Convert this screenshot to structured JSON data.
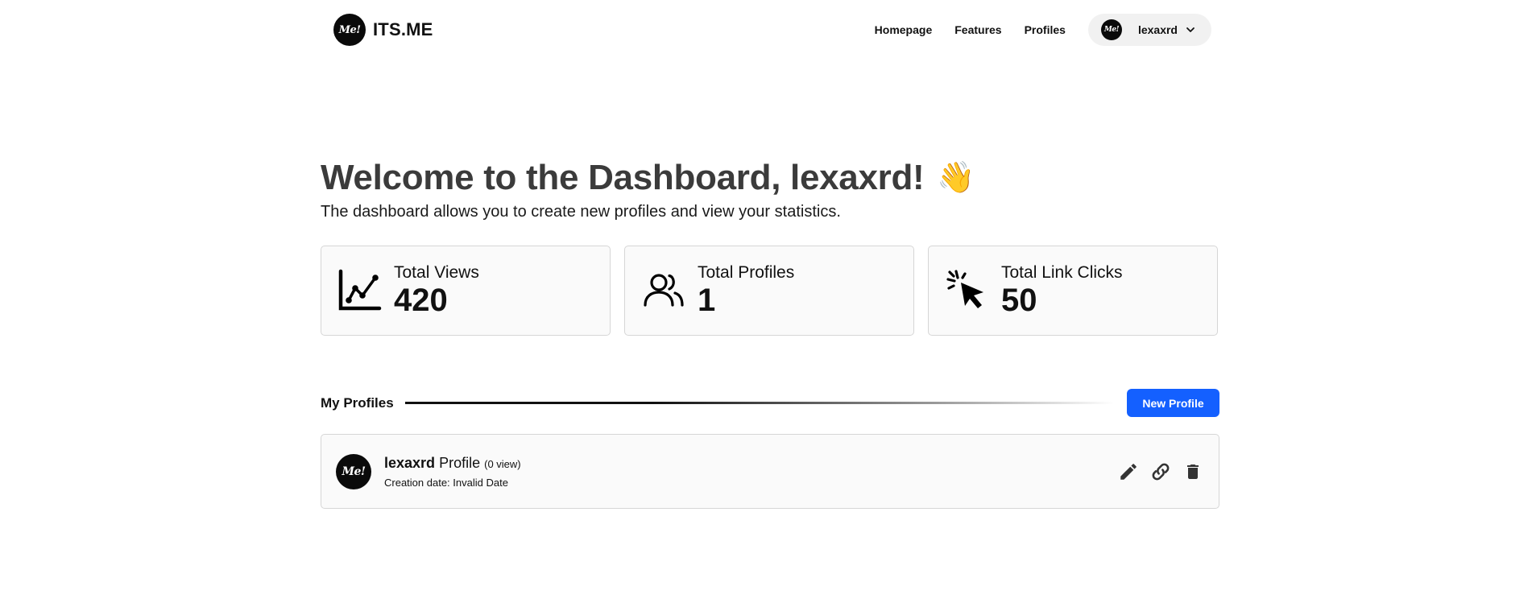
{
  "nav": {
    "brand": "ITS.ME",
    "logo_text": "Me!",
    "links": [
      "Homepage",
      "Features",
      "Profiles"
    ],
    "user": "lexaxrd"
  },
  "hero": {
    "title": "Welcome to the Dashboard, lexaxrd!",
    "emoji": "👋",
    "subtitle": "The dashboard allows you to create new profiles and view your statistics."
  },
  "stats": [
    {
      "label": "Total Views",
      "value": "420",
      "icon": "chart-line-icon"
    },
    {
      "label": "Total Profiles",
      "value": "1",
      "icon": "users-icon"
    },
    {
      "label": "Total Link Clicks",
      "value": "50",
      "icon": "cursor-click-icon"
    }
  ],
  "profiles_section": {
    "title": "My Profiles",
    "new_button": "New Profile"
  },
  "profiles": [
    {
      "name": "lexaxrd",
      "suffix": "Profile",
      "views": "(0 view)",
      "date": "Creation date: Invalid Date"
    }
  ],
  "colors": {
    "accent": "#1460ff",
    "title": "#3b3b3b",
    "card_bg": "#fafafa",
    "card_border": "#d6d6d6"
  }
}
